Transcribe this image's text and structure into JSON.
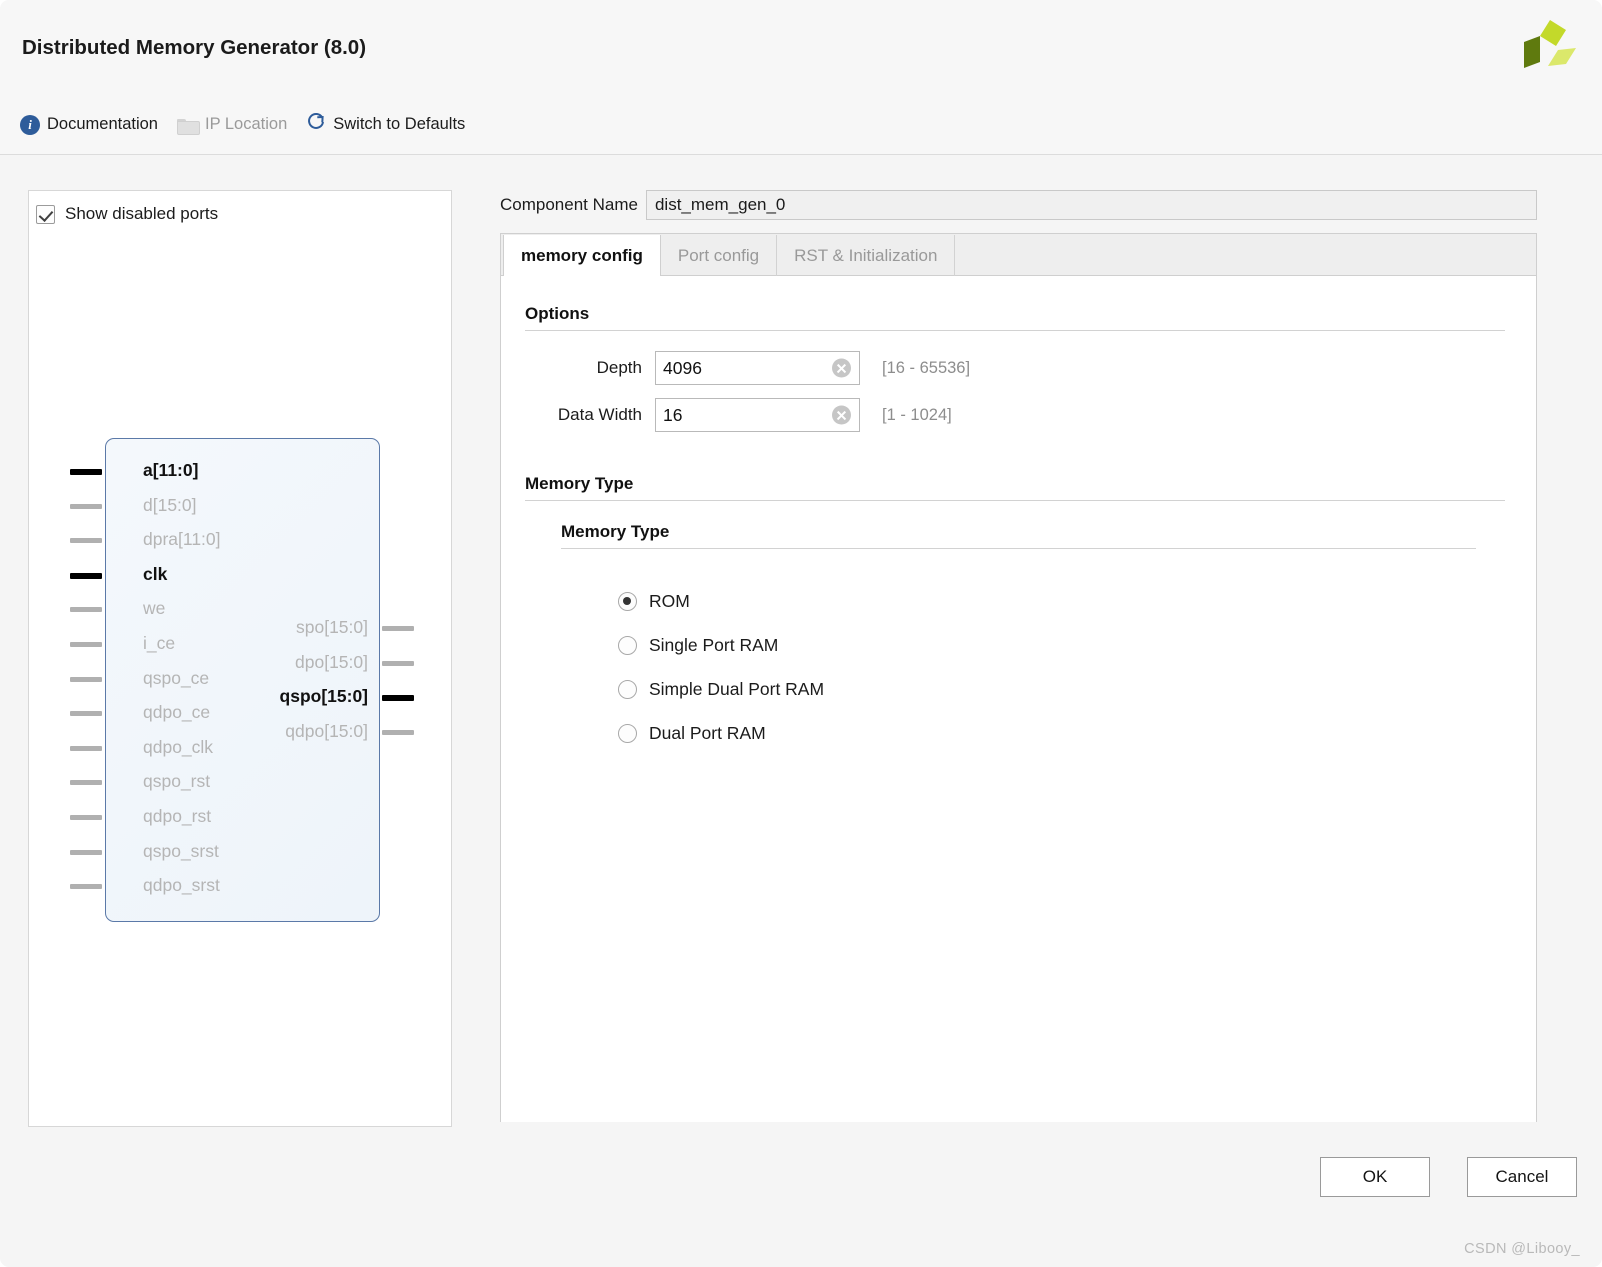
{
  "window": {
    "title": "Distributed Memory Generator (8.0)",
    "logo_icon": "xilinx-pinwheel-logo",
    "logo_colors": [
      "#c3d92a",
      "#5f7a0e",
      "#dbe86b"
    ]
  },
  "toolbar": {
    "items": [
      {
        "label": "Documentation",
        "icon": "info-icon",
        "disabled": false
      },
      {
        "label": "IP Location",
        "icon": "folder-icon",
        "disabled": true
      },
      {
        "label": "Switch to Defaults",
        "icon": "refresh-icon",
        "disabled": false
      }
    ]
  },
  "left_panel": {
    "show_disabled_ports": {
      "label": "Show disabled ports",
      "checked": true
    },
    "symbol": {
      "inputs": [
        {
          "name": "a[11:0]",
          "active": true
        },
        {
          "name": "d[15:0]",
          "active": false
        },
        {
          "name": "dpra[11:0]",
          "active": false
        },
        {
          "name": "clk",
          "active": true
        },
        {
          "name": "we",
          "active": false
        },
        {
          "name": "i_ce",
          "active": false
        },
        {
          "name": "qspo_ce",
          "active": false
        },
        {
          "name": "qdpo_ce",
          "active": false
        },
        {
          "name": "qdpo_clk",
          "active": false
        },
        {
          "name": "qspo_rst",
          "active": false
        },
        {
          "name": "qdpo_rst",
          "active": false
        },
        {
          "name": "qspo_srst",
          "active": false
        },
        {
          "name": "qdpo_srst",
          "active": false
        }
      ],
      "outputs": [
        {
          "name": "spo[15:0]",
          "active": false
        },
        {
          "name": "dpo[15:0]",
          "active": false
        },
        {
          "name": "qspo[15:0]",
          "active": true
        },
        {
          "name": "qdpo[15:0]",
          "active": false
        }
      ]
    }
  },
  "right_panel": {
    "component_name": {
      "label": "Component Name",
      "value": "dist_mem_gen_0"
    },
    "tabs": [
      {
        "label": "memory config",
        "active": true
      },
      {
        "label": "Port config",
        "active": false
      },
      {
        "label": "RST & Initialization",
        "active": false
      }
    ],
    "options": {
      "title": "Options",
      "fields": [
        {
          "label": "Depth",
          "value": "4096",
          "range": "[16 - 65536]",
          "clear_icon": "clear-icon"
        },
        {
          "label": "Data Width",
          "value": "16",
          "range": "[1 - 1024]",
          "clear_icon": "clear-icon"
        }
      ]
    },
    "memory_type": {
      "title": "Memory Type",
      "group_title": "Memory Type",
      "options": [
        {
          "label": "ROM",
          "selected": true
        },
        {
          "label": "Single Port RAM",
          "selected": false
        },
        {
          "label": "Simple Dual Port RAM",
          "selected": false
        },
        {
          "label": "Dual Port RAM",
          "selected": false
        }
      ]
    }
  },
  "footer": {
    "ok_label": "OK",
    "cancel_label": "Cancel",
    "watermark": "CSDN @Libooy_"
  }
}
